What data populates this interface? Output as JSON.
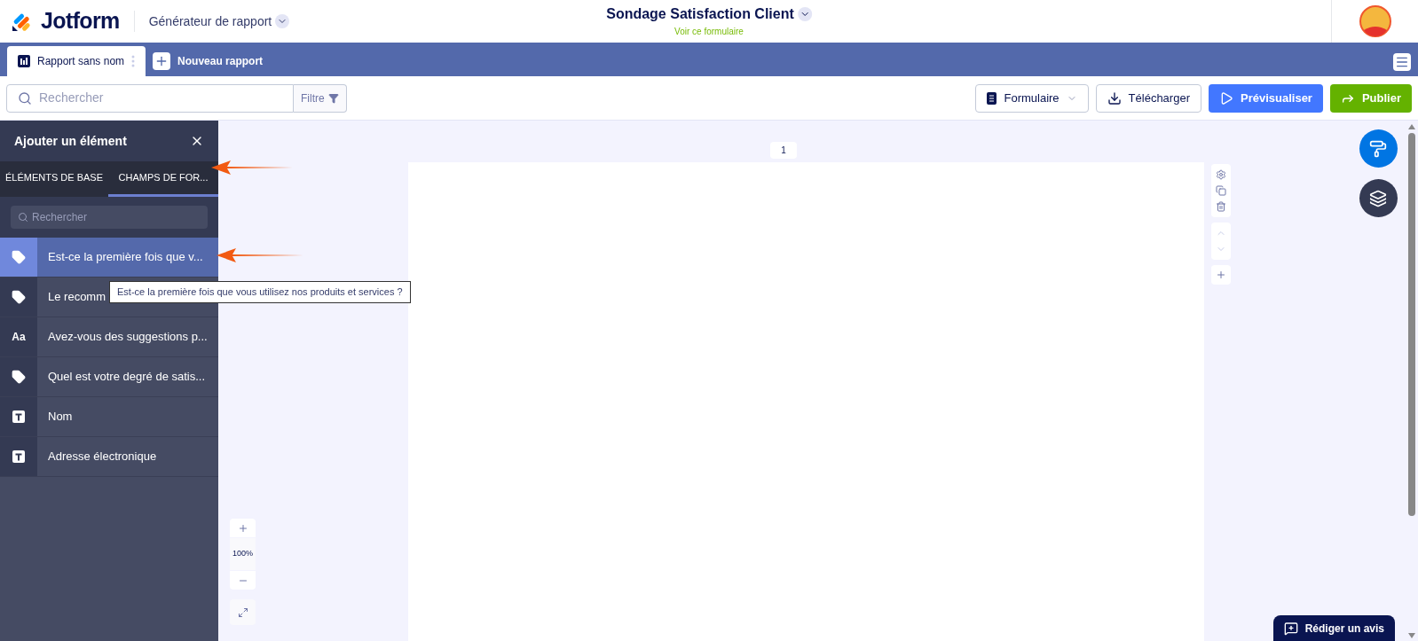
{
  "header": {
    "logo": "Jotform",
    "app_switcher": "Générateur de rapport",
    "form_title": "Sondage Satisfaction Client",
    "form_link": "Voir ce formulaire"
  },
  "report_tabs": [
    {
      "label": "Rapport sans nom",
      "selected": true
    }
  ],
  "new_report": "Nouveau rapport",
  "toolbar": {
    "search_placeholder": "Rechercher",
    "filter": "Filtre",
    "form_button": "Formulaire",
    "download": "Télécharger",
    "preview": "Prévisualiser",
    "publish": "Publier"
  },
  "panel": {
    "title": "Ajouter un élément",
    "tabs": [
      {
        "label": "ÉLÉMENTS DE BASE",
        "selected": false
      },
      {
        "label": "CHAMPS DE FOR...",
        "selected": true
      }
    ],
    "search_placeholder": "Rechercher",
    "items": [
      {
        "kind": "tag",
        "label": "Est-ce la première fois que v...",
        "selected": true
      },
      {
        "kind": "tag",
        "label": "Le recomm",
        "selected": false
      },
      {
        "kind": "textbox",
        "icon_text": "Aa",
        "label": "Avez-vous des suggestions p...",
        "selected": false
      },
      {
        "kind": "tag",
        "label": "Quel est votre degré de satis...",
        "selected": false
      },
      {
        "kind": "text",
        "label": "Nom",
        "selected": false
      },
      {
        "kind": "text",
        "label": "Adresse électronique",
        "selected": false
      }
    ]
  },
  "tooltip": "Est-ce la première fois que vous utilisez nos produits et services ?",
  "canvas": {
    "page_number": "1",
    "zoom": "100%"
  },
  "feedback_button": "Rédiger un avis"
}
